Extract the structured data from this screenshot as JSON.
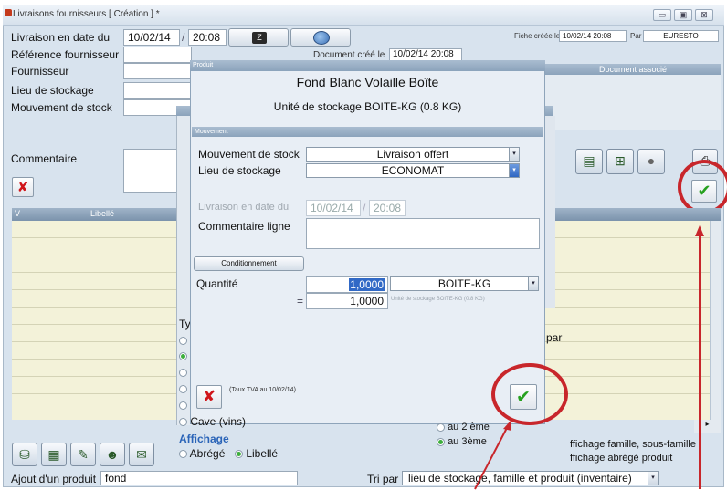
{
  "window": {
    "title": "Livraisons fournisseurs  [ Création ] *",
    "controls": [
      "▭",
      "▣",
      "⊠"
    ]
  },
  "form": {
    "livraison_label": "Livraison en date du",
    "livraison_date": "10/02/14",
    "livraison_time": "20:08",
    "ref_label": "Référence fournisseur",
    "fournisseur_label": "Fournisseur",
    "lieu_label": "Lieu de stockage",
    "mouvement_label": "Mouvement de stock",
    "commentaire_label": "Commentaire",
    "fiche_label": "Fiche créée le",
    "fiche_date": "10/02/14 20:08",
    "par_label": "Par",
    "par_value": "EURESTO",
    "doc_associe": "Document associé",
    "bg_date_fragment": "10/02/14 20:08",
    "bg_label_fragment": "Document créé le"
  },
  "grid": {
    "col_v": "V",
    "col_libelle": "Libellé"
  },
  "bottom": {
    "type_label": "Ty",
    "cave_label": "Cave (vins)",
    "affichage_label": "Affichage",
    "abrege_label": "Abrégé",
    "libelle_label": "Libellé",
    "au2_label": "au 2 ème",
    "au3_label": "au 3ème",
    "par_text": "par",
    "affichage_famille": "ffichage famille, sous-famille",
    "affichage_abrege": "ffichage abrégé produit",
    "ajout_label": "Ajout d'un produit",
    "ajout_value": "fond",
    "tri_label": "Tri par",
    "tri_value": "lieu de stockage, famille et produit (inventaire)"
  },
  "modal": {
    "title_bar": "Produit",
    "product_name": "Fond Blanc Volaille Boîte",
    "unit_line": "Unité de stockage BOITE-KG (0.8 KG)",
    "section": "Mouvement",
    "mouvement_label": "Mouvement de stock",
    "mouvement_value": "Livraison offert",
    "lieu_label": "Lieu de stockage",
    "lieu_value": "ECONOMAT",
    "livraison_label": "Livraison en date du",
    "livraison_date": "10/02/14",
    "livraison_time": "20:08",
    "commentaire_label": "Commentaire ligne",
    "conditionnement_button": "Conditionnement",
    "quantite_label": "Quantité",
    "quantite_value": "1,0000",
    "unit_value": "BOITE-KG",
    "equals": "=",
    "converted_value": "1,0000",
    "converted_note": "Unité de stockage BOITE-KG (0.8 KG)",
    "tva_note": "(Taux TVA au 10/02/14)"
  },
  "colors": {
    "callout_red": "#c8262b",
    "window_bg": "#d8e3ee",
    "grid_bg": "#f3f2d9",
    "header_blue": "#7b93ac"
  }
}
